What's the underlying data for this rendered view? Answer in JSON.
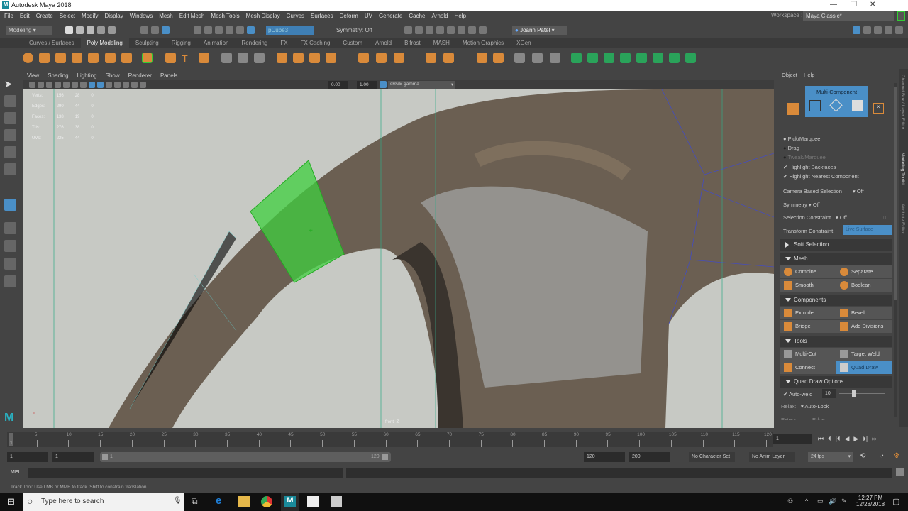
{
  "window": {
    "title": "Autodesk Maya 2018",
    "minimize": "—",
    "restore": "❐",
    "close": "✕"
  },
  "menubar": [
    "File",
    "Edit",
    "Create",
    "Select",
    "Modify",
    "Display",
    "Windows",
    "Mesh",
    "Edit Mesh",
    "Mesh Tools",
    "Mesh Display",
    "Curves",
    "Surfaces",
    "Deform",
    "UV",
    "Generate",
    "Cache",
    "Arnold",
    "Help"
  ],
  "statusline": {
    "menuset": "Modeling",
    "object_field": "pCube3",
    "symmetry": "Symmetry: Off",
    "user": "Joann Patel",
    "workspace_label": "Workspace :",
    "workspace": "Maya Classic*"
  },
  "shelf_tabs": [
    "Curves / Surfaces",
    "Poly Modeling",
    "Sculpting",
    "Rigging",
    "Animation",
    "Rendering",
    "FX",
    "FX Caching",
    "Custom",
    "Arnold",
    "Bifrost",
    "MASH",
    "Motion Graphics",
    "XGen"
  ],
  "shelf_active": "Poly Modeling",
  "panel_menu": [
    "View",
    "Shading",
    "Lighting",
    "Show",
    "Renderer",
    "Panels"
  ],
  "panel_toolbar": {
    "exposure": "0.00",
    "gamma": "1.00",
    "color_space": "sRGB gamma"
  },
  "hud": [
    {
      "label": "Verts:",
      "a": "156",
      "b": "28",
      "c": "0"
    },
    {
      "label": "Edges:",
      "a": "290",
      "b": "44",
      "c": "0"
    },
    {
      "label": "Faces:",
      "a": "138",
      "b": "19",
      "c": "0"
    },
    {
      "label": "Tris:",
      "a": "276",
      "b": "38",
      "c": "0"
    },
    {
      "label": "UVs:",
      "a": "225",
      "b": "44",
      "c": "0"
    }
  ],
  "viewport_camera_label": "front -Z",
  "modeling_toolkit": {
    "menu": [
      "Object",
      "Help"
    ],
    "mode": "Multi-Component",
    "pick_marquee": "Pick/Marquee",
    "drag": "Drag",
    "tweak_marquee": "Tweak/Marquee",
    "highlight_backfaces": "Highlight Backfaces",
    "highlight_nearest": "Highlight Nearest Component",
    "camera_based_selection_label": "Camera Based Selection",
    "camera_based_selection": "Off",
    "symmetry_label": "Symmetry",
    "symmetry": "Off",
    "selection_constraint_label": "Selection Constraint",
    "selection_constraint": "Off",
    "selection_constraint_value": "0",
    "transform_constraint_label": "Transform Constraint",
    "transform_constraint": "Live Surface",
    "soft_selection": "Soft Selection",
    "mesh_section": "Mesh",
    "combine": "Combine",
    "separate": "Separate",
    "smooth": "Smooth",
    "boolean": "Boolean",
    "components_section": "Components",
    "extrude": "Extrude",
    "bevel": "Bevel",
    "bridge": "Bridge",
    "add_divisions": "Add Divisions",
    "tools_section": "Tools",
    "multi_cut": "Multi-Cut",
    "target_weld": "Target Weld",
    "connect": "Connect",
    "quad_draw": "Quad Draw",
    "quad_draw_options": "Quad Draw Options",
    "auto_weld": "Auto-weld",
    "auto_weld_value": "10",
    "auto_weld_slider": 0.3,
    "relax_label": "Relax:",
    "relax": "Auto-Lock",
    "extend_label": "Extend:",
    "extend": "Edge"
  },
  "vertical_tabs": [
    "Channel Box / Layer Editor",
    "Modeling Toolkit",
    "Attribute Editor"
  ],
  "timeline": {
    "ticks": [
      "5",
      "10",
      "15",
      "20",
      "25",
      "30",
      "35",
      "40",
      "45",
      "50",
      "55",
      "60",
      "65",
      "70",
      "75",
      "80",
      "85",
      "90",
      "95",
      "100",
      "105",
      "110",
      "115",
      "120"
    ],
    "current_frame_marker": "1",
    "current_frame": "1"
  },
  "range": {
    "start": "1",
    "anim_start": "1",
    "slider_start": "1",
    "slider_end": "120",
    "end": "120",
    "anim_end": "200",
    "character_set": "No Character Set",
    "anim_layer": "No Anim Layer",
    "fps": "24 fps"
  },
  "mel": {
    "label": "MEL"
  },
  "help_line": "Track Tool: Use LMB or MMB to track. Shift to constrain translation.",
  "taskbar": {
    "search_placeholder": "Type here to search",
    "time": "12:27 PM",
    "date": "12/28/2018"
  },
  "colors": {
    "accent": "#4a8fc7",
    "selection": "#3fcf3f",
    "orange": "#d98a3a"
  }
}
